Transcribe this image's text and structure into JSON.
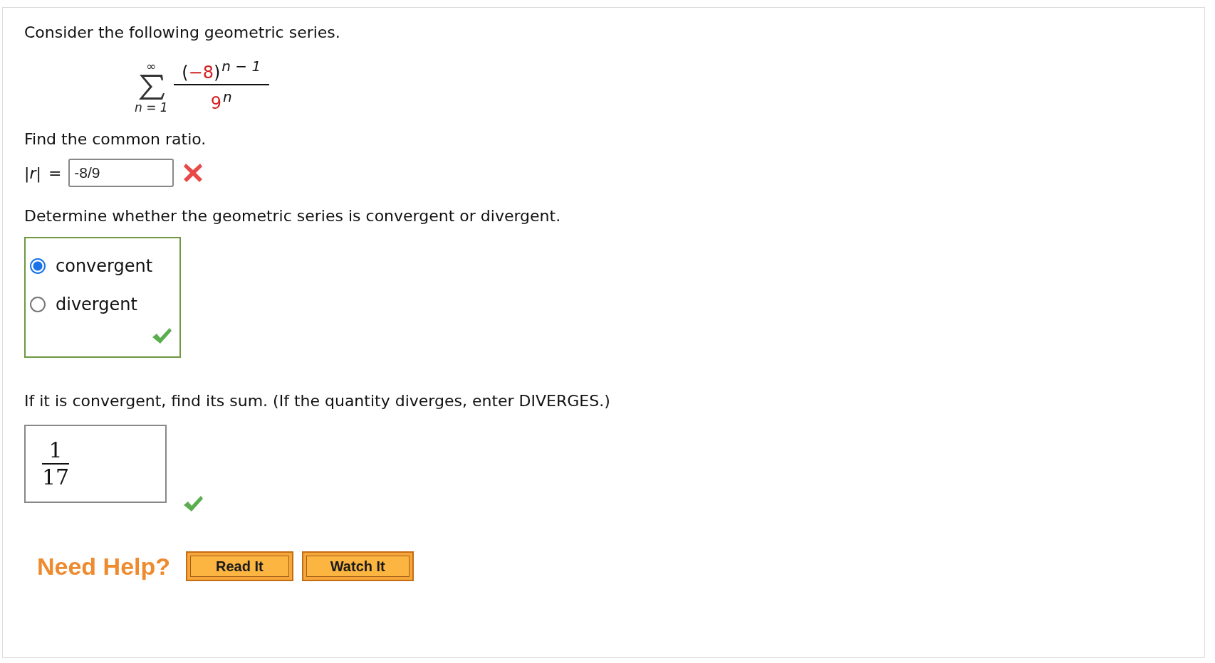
{
  "intro": "Consider the following geometric series.",
  "series": {
    "upper": "∞",
    "lower": "n = 1",
    "numerator_open": "(",
    "numerator_value": "−8",
    "numerator_close": ")",
    "numerator_exponent": "n − 1",
    "denominator_base": "9",
    "denominator_exponent": "n"
  },
  "questions": [
    {
      "kind": "ratio",
      "prompt": "Find the common ratio.",
      "lhs": "|*r*|",
      "equals": "=",
      "value": "-8/9",
      "correct": false
    },
    {
      "kind": "choice",
      "prompt": "Determine whether the geometric series is convergent or divergent.",
      "options": [
        {
          "label": "convergent",
          "selected": true
        },
        {
          "label": "divergent",
          "selected": false
        }
      ],
      "correct": true
    },
    {
      "kind": "sum",
      "prompt": "If it is convergent, find its sum. (If the quantity diverges, enter DIVERGES.)",
      "numerator": "1",
      "denominator": "17",
      "correct": true
    }
  ],
  "help": {
    "label": "Need Help?",
    "buttons": [
      "Read It",
      "Watch It"
    ]
  }
}
